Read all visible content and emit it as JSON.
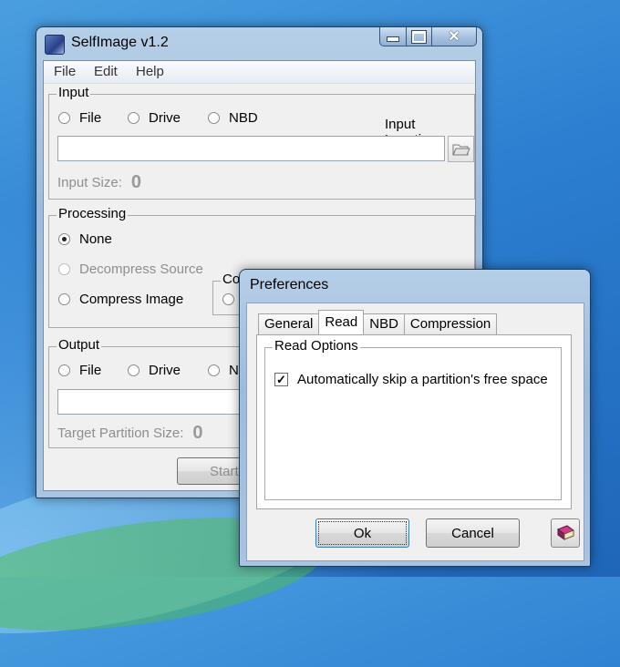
{
  "main_window": {
    "title": "SelfImage v1.2",
    "menu": [
      "File",
      "Edit",
      "Help"
    ],
    "input": {
      "group_label": "Input",
      "options": [
        "File",
        "Drive",
        "NBD"
      ],
      "location_label": "Input Location:",
      "location_value": "",
      "size_label": "Input Size:",
      "size_value": "0"
    },
    "processing": {
      "group_label": "Processing",
      "options": [
        "None",
        "Decompress Source",
        "Compress Image"
      ],
      "selected": "None",
      "sub_group_label": "Co"
    },
    "output": {
      "group_label": "Output",
      "options": [
        "File",
        "Drive",
        "N"
      ],
      "target_label": "Target Partition Size:",
      "target_value": "0"
    },
    "start_button": "Start"
  },
  "preferences": {
    "title": "Preferences",
    "tabs": [
      "General",
      "Read",
      "NBD",
      "Compression"
    ],
    "active_tab": "Read",
    "read_options_label": "Read Options",
    "skip_free_space_label": "Automatically skip a partition's free space",
    "skip_free_space_checked": true,
    "ok_label": "Ok",
    "cancel_label": "Cancel"
  },
  "icons": {
    "app": "selfimage-app-icon",
    "folder": "open-folder-icon",
    "help": "help-book-icon"
  },
  "colors": {
    "desktop": "#2b7ed0",
    "client": "#f0f0f0",
    "disabled_text": "#8e8e8e"
  }
}
